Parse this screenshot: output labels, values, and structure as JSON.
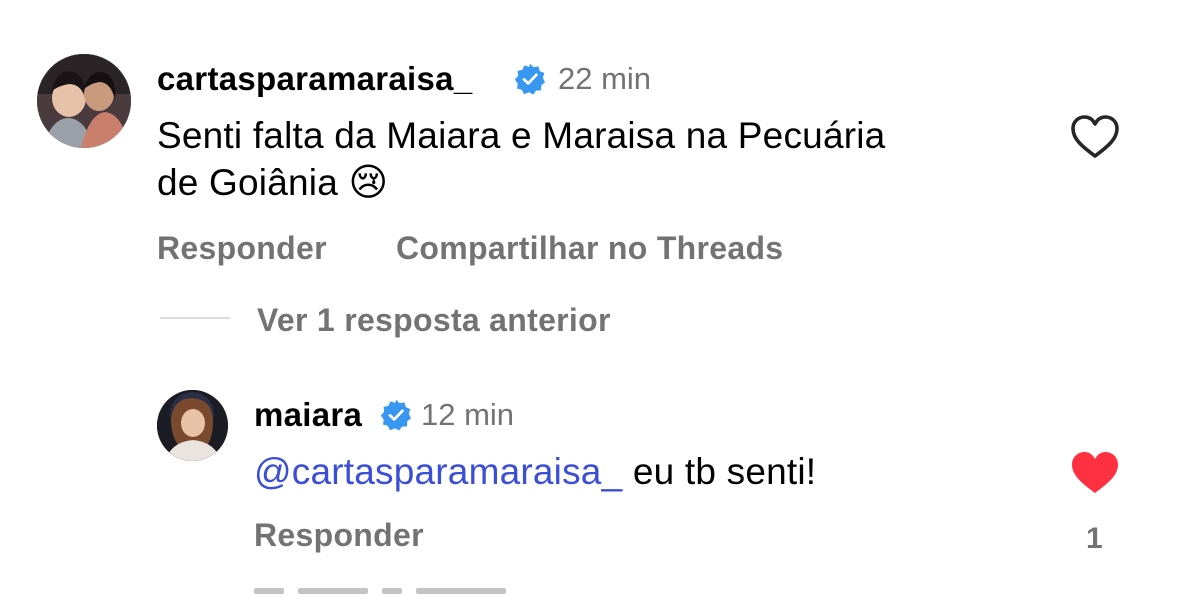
{
  "comments": [
    {
      "username": "cartasparamaraisa_",
      "verified": true,
      "time": "22 min",
      "text_line1": "Senti falta da Maiara e Maraisa na Pecuária",
      "text_line2": "de Goiânia",
      "emoji": "😢",
      "actions": {
        "reply": "Responder",
        "share": "Compartilhar no Threads"
      },
      "liked": false
    }
  ],
  "thread": {
    "view_previous": "Ver 1 resposta anterior"
  },
  "reply": {
    "username": "maiara",
    "verified": true,
    "time": "12 min",
    "mention": "@cartasparamaraisa_",
    "text": "eu tb senti!",
    "actions": {
      "reply": "Responder"
    },
    "liked": true,
    "like_count": "1"
  },
  "colors": {
    "verified_blue": "#3897f0",
    "mention_blue": "#3b4fd6",
    "heart_red": "#ff3040",
    "secondary_gray": "#737373"
  },
  "icons": {
    "verified": "verified-badge-icon",
    "like_empty": "heart-outline-icon",
    "like_filled": "heart-filled-icon"
  }
}
